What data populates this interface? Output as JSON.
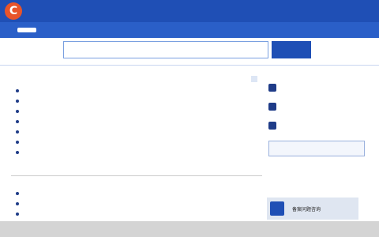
{
  "header": {
    "logo_letter": "C",
    "title": ""
  },
  "nav": {
    "items": [
      "",
      "",
      "",
      "",
      "",
      "",
      ""
    ]
  },
  "search": {
    "placeholder": "",
    "button": ""
  },
  "section1": {
    "title": "",
    "more": "",
    "sub": "",
    "rows": [
      {
        "title": "",
        "cat": "",
        "date": ""
      },
      {
        "title": "",
        "cat": "",
        "date": ""
      },
      {
        "title": "",
        "cat": "",
        "date": ""
      },
      {
        "title": "",
        "cat": "",
        "date": ""
      },
      {
        "title": "",
        "cat": "",
        "date": ""
      },
      {
        "title": "",
        "cat": "",
        "date": ""
      },
      {
        "title": "",
        "cat": "",
        "date": ""
      }
    ]
  },
  "section2": {
    "title": "",
    "rows": [
      {
        "title": "",
        "cat": "",
        "date": ""
      },
      {
        "title": "",
        "cat": "",
        "date": ""
      },
      {
        "title": "",
        "cat": "",
        "date": ""
      }
    ]
  },
  "side": {
    "tab1": "",
    "tab2": "",
    "items": [
      "",
      "",
      ""
    ],
    "button": ""
  },
  "promo": {
    "label": "备案问题咨询"
  },
  "banner": {
    "text": ""
  }
}
